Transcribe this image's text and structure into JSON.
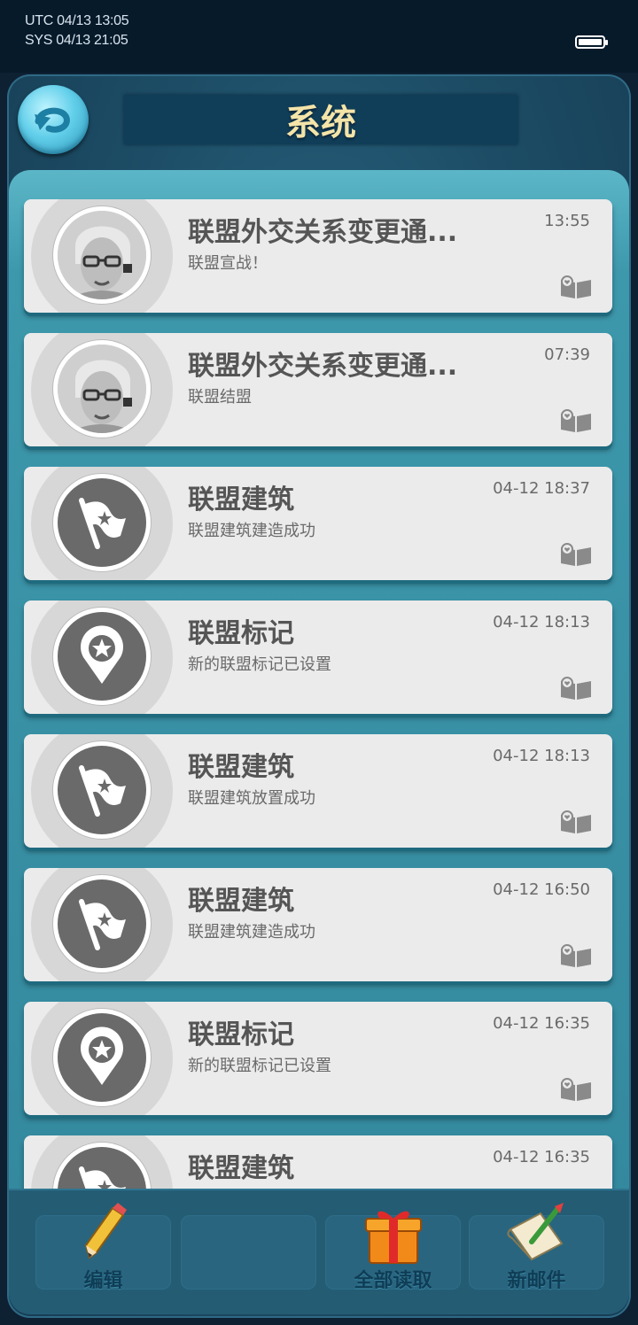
{
  "status_bar": {
    "utc": "UTC 04/13 13:05",
    "sys": "SYS 04/13 21:05",
    "battery_icon": "battery-full-icon"
  },
  "header": {
    "title": "系统",
    "back_icon": "back-arrow-icon"
  },
  "mails": [
    {
      "title": "联盟外交关系变更通...",
      "subtitle": "联盟宣战！",
      "time": "13:55",
      "avatar": "advisor-portrait"
    },
    {
      "title": "联盟外交关系变更通...",
      "subtitle": "联盟结盟",
      "time": "07:39",
      "avatar": "advisor-portrait"
    },
    {
      "title": "联盟建筑",
      "subtitle": "联盟建筑建造成功",
      "time": "04-12 18:37",
      "avatar": "flag-star-icon"
    },
    {
      "title": "联盟标记",
      "subtitle": "新的联盟标记已设置",
      "time": "04-12 18:13",
      "avatar": "map-pin-star-icon"
    },
    {
      "title": "联盟建筑",
      "subtitle": "联盟建筑放置成功",
      "time": "04-12 18:13",
      "avatar": "flag-star-icon"
    },
    {
      "title": "联盟建筑",
      "subtitle": "联盟建筑建造成功",
      "time": "04-12 16:50",
      "avatar": "flag-star-icon"
    },
    {
      "title": "联盟标记",
      "subtitle": "新的联盟标记已设置",
      "time": "04-12 16:35",
      "avatar": "map-pin-star-icon"
    },
    {
      "title": "联盟建筑",
      "subtitle": "",
      "time": "04-12 16:35",
      "avatar": "flag-star-icon"
    }
  ],
  "toolbar": {
    "edit_label": "编辑",
    "empty_label": "",
    "read_all_label": "全部读取",
    "new_mail_label": "新邮件"
  },
  "colors": {
    "title_text": "#f4e4a8",
    "card_bg": "#ebebeb",
    "panel_teal": "#3d98ac"
  }
}
